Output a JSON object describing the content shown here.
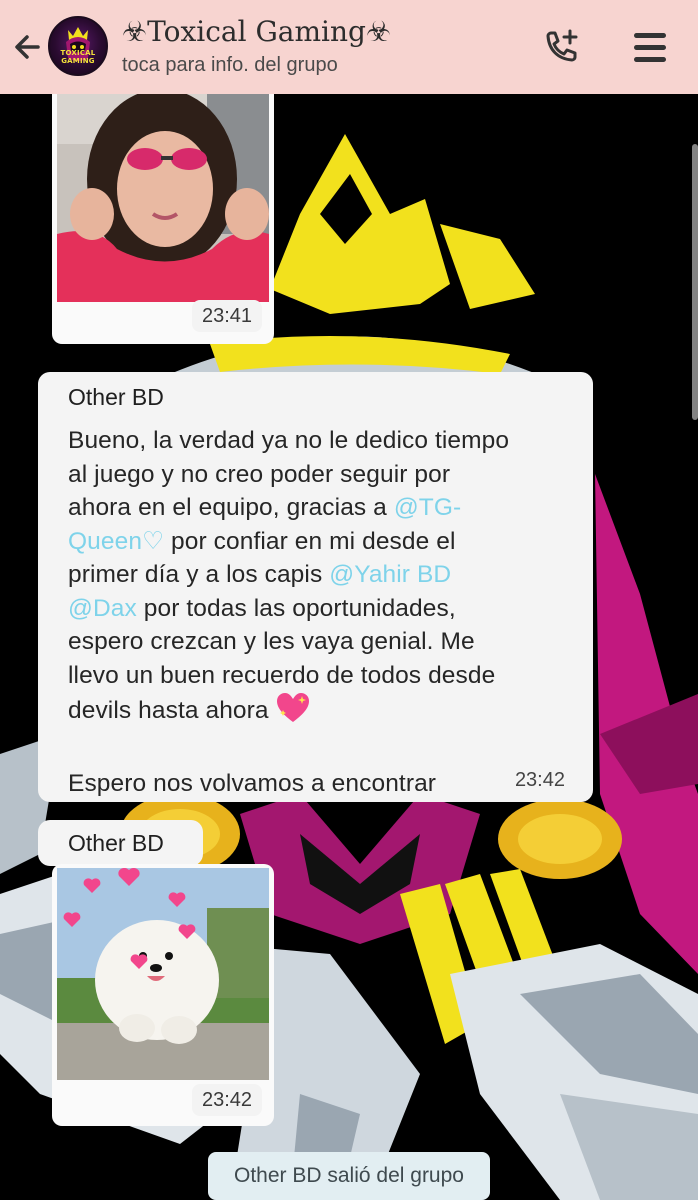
{
  "header": {
    "title": "☣Toxical Gaming☣",
    "subtitle": "toca para info. del grupo",
    "avatar_text": "TOXICAL GAMING"
  },
  "messages": [
    {
      "type": "image",
      "depicts": "girl-with-pink-sunglasses-photo",
      "time": "23:41"
    },
    {
      "type": "text",
      "sender": "Other BD",
      "line1": "Bueno, la verdad ya no le dedico tiempo",
      "line2": "al juego y no creo poder seguir por",
      "line3a": "ahora en el equipo, gracias a ",
      "mention1a": "@TG-",
      "mention1b": "Queen♡",
      "line4": " por confiar en mi desde el",
      "line5a": "primer día y a los capis ",
      "mention2": "@Yahir BD",
      "mention3": "@Dax",
      "line6": " por todas las oportunidades,",
      "line7": "espero crezcan y les vaya genial. Me",
      "line8": "llevo un buen recuerdo de todos desde",
      "line9": "devils hasta ahora ",
      "line10": "Espero nos volvamos a encontrar",
      "time": "23:42"
    },
    {
      "type": "image",
      "sender": "Other BD",
      "depicts": "white-pomeranian-with-hearts-photo",
      "time": "23:42"
    }
  ],
  "system_message": "Other BD salió del grupo",
  "colors": {
    "header_bg": "#f7d4d0",
    "mention": "#7ed3ea",
    "bubble": "#f4f4f4",
    "wallpaper_bg": "#000000",
    "wallpaper_yellow": "#f2e11d",
    "wallpaper_magenta": "#c2187f"
  }
}
